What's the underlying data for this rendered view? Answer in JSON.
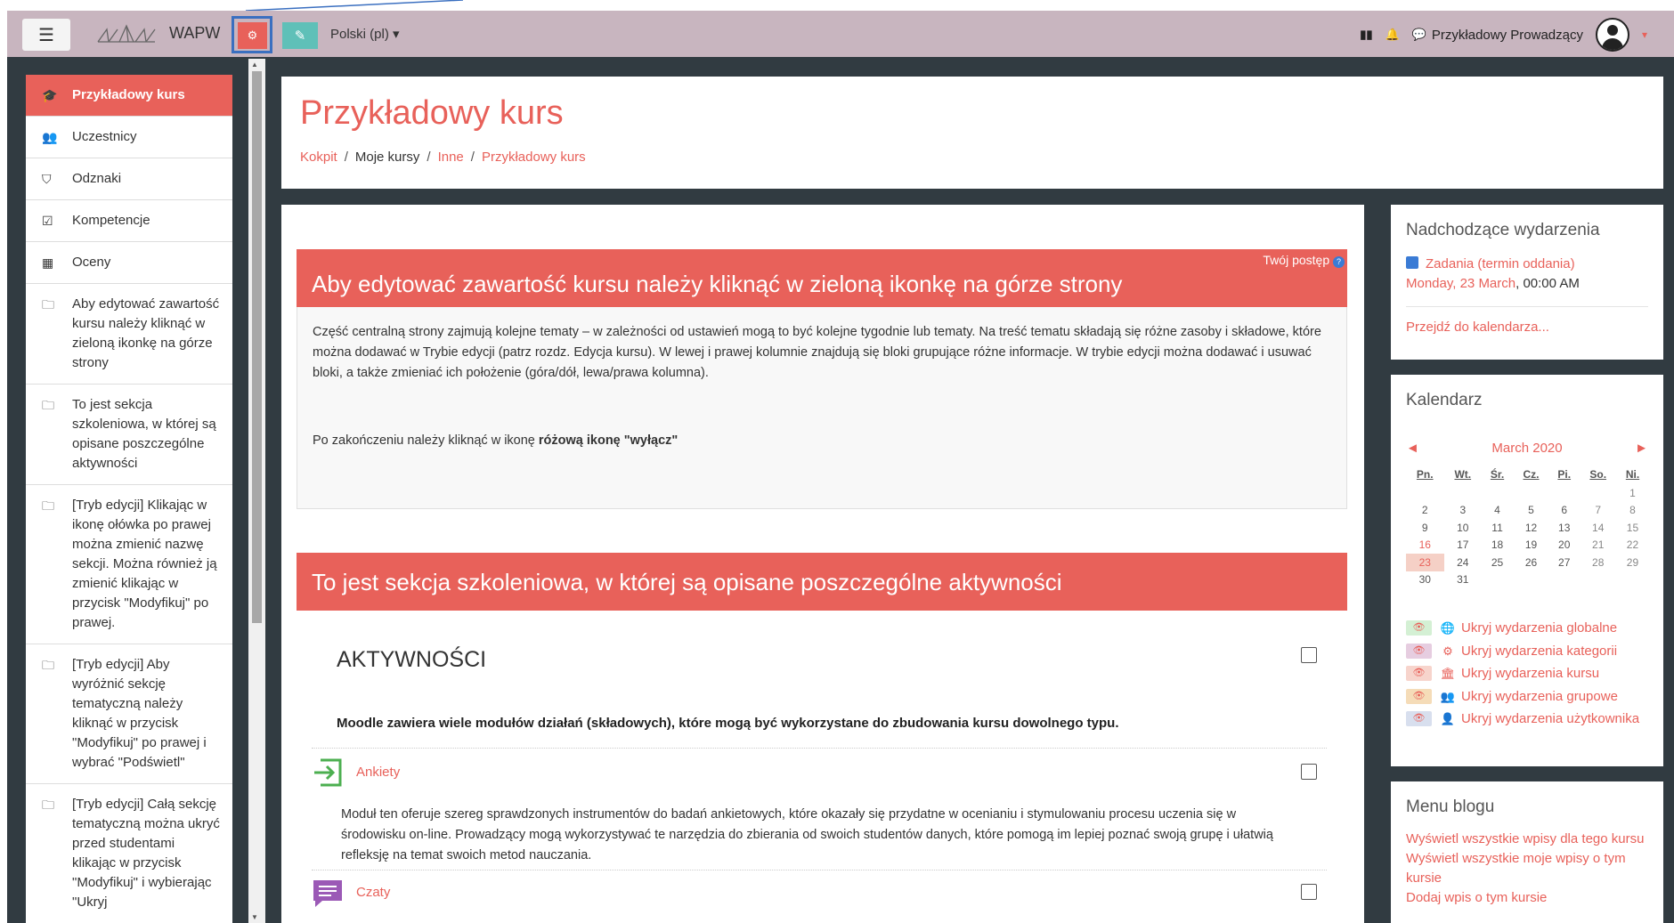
{
  "navbar": {
    "brand": "WAPW",
    "language": "Polski (pl)",
    "language_caret": "▾",
    "user_name": "Przykładowy Prowadzący",
    "user_caret": "▾",
    "icons": {
      "burger": "☰",
      "gear": "⚙",
      "edit": "✎",
      "map": "▮▮",
      "bell": "🔔",
      "chat": "💬"
    }
  },
  "leftnav": {
    "items": [
      {
        "label": "Przykładowy kurs",
        "icon": "🎓"
      },
      {
        "label": "Uczestnicy",
        "icon": "👥"
      },
      {
        "label": "Odznaki",
        "icon": "⛉"
      },
      {
        "label": "Kompetencje",
        "icon": "☑"
      },
      {
        "label": "Oceny",
        "icon": "▦"
      },
      {
        "label": "Aby edytować zawartość kursu należy kliknąć w zieloną ikonkę na górze strony",
        "icon": "🗀"
      },
      {
        "label": "To jest sekcja szkoleniowa, w której są opisane poszczególne aktywności",
        "icon": "🗀"
      },
      {
        "label": "[Tryb edycji] Klikając w ikonę ołówka po prawej można zmienić nazwę sekcji. Można również ją zmienić klikając w przycisk \"Modyfikuj\" po prawej.",
        "icon": "🗀"
      },
      {
        "label": "[Tryb edycji] Aby wyróżnić sekcję tematyczną należy kliknąć w przycisk \"Modyfikuj\" po prawej i wybrać \"Podświetl\"",
        "icon": "🗀"
      },
      {
        "label": "[Tryb edycji] Całą sekcję tematyczną można ukryć przed studentami klikając w przycisk \"Modyfikuj\" i wybierając \"Ukryj",
        "icon": "🗀"
      }
    ]
  },
  "header": {
    "title": "Przykładowy kurs",
    "breadcrumb": [
      "Kokpit",
      "Moje kursy",
      "Inne",
      "Przykładowy kurs"
    ],
    "breadcrumb_sep": "/"
  },
  "main": {
    "progress_label": "Twój postęp",
    "progress_help": "?",
    "section1": {
      "title": "Aby edytować zawartość kursu należy kliknąć w zieloną ikonkę na górze strony",
      "para1": "Część centralną strony zajmują kolejne tematy – w zależności od ustawień  mogą to być kolejne tygodnie lub tematy. Na treść tematu składają się różne zasoby i składowe, które można dodawać w Trybie edycji (patrz rozdz. Edycja kursu). W lewej i prawej kolumnie znajdują się bloki grupujące różne informacje. W trybie edycji można dodawać i usuwać bloki, a także zmieniać ich położenie (góra/dół, lewa/prawa kolumna).",
      "para2_prefix": "Po zakończeniu należy kliknąć w ikonę ",
      "para2_bold": "różową ikonę \"wyłącz\""
    },
    "section2": {
      "title": "To jest sekcja szkoleniowa, w której są opisane poszczególne aktywności",
      "heading": "AKTYWNOŚCI",
      "note": "Moodle zawiera wiele modułów działań (składowych), które mogą być wykorzystane do zbudowania kursu dowolnego typu.",
      "activities": [
        {
          "label": "Ankiety",
          "desc": "Moduł ten oferuje szereg sprawdzonych instrumentów do badań ankietowych, które okazały się przydatne w ocenianiu i stymulowaniu procesu uczenia się w środowisku on-line. Prowadzący mogą wykorzystywać te narzędzia do zbierania od swoich studentów danych, które pomogą im lepiej poznać swoją grupę i ułatwią refleksję na temat swoich metod nauczania."
        },
        {
          "label": "Czaty",
          "desc": ""
        }
      ]
    }
  },
  "right": {
    "upcoming": {
      "title": "Nadchodzące wydarzenia",
      "event_title": "Zadania (termin oddania)",
      "event_date": "Monday, 23 March",
      "event_time": ", 00:00 AM",
      "calendar_link": "Przejdź do kalendarza..."
    },
    "calendar": {
      "title": "Kalendarz",
      "prev": "◄",
      "next": "►",
      "month": "March 2020",
      "weekdays": [
        "Pn.",
        "Wt.",
        "Śr.",
        "Cz.",
        "Pi.",
        "So.",
        "Ni."
      ],
      "weeks": [
        [
          "",
          "",
          "",
          "",
          "",
          "",
          "1"
        ],
        [
          "2",
          "3",
          "4",
          "5",
          "6",
          "7",
          "8"
        ],
        [
          "9",
          "10",
          "11",
          "12",
          "13",
          "14",
          "15"
        ],
        [
          "16",
          "17",
          "18",
          "19",
          "20",
          "21",
          "22"
        ],
        [
          "23",
          "24",
          "25",
          "26",
          "27",
          "28",
          "29"
        ],
        [
          "30",
          "31",
          "",
          "",
          "",
          "",
          ""
        ]
      ],
      "filters": [
        {
          "label": "Ukryj wydarzenia globalne",
          "icon": "🌐",
          "bg": "#d4f0d4"
        },
        {
          "label": "Ukryj wydarzenia kategorii",
          "icon": "⚙",
          "bg": "#e6cde0"
        },
        {
          "label": "Ukryj wydarzenia kursu",
          "icon": "🏛",
          "bg": "#f7d4cc"
        },
        {
          "label": "Ukryj wydarzenia grupowe",
          "icon": "👥",
          "bg": "#f5dcb8"
        },
        {
          "label": "Ukryj wydarzenia użytkownika",
          "icon": "👤",
          "bg": "#d8dfee"
        }
      ],
      "eye": "👁"
    },
    "blog": {
      "title": "Menu blogu",
      "links": [
        "Wyświetl wszystkie wpisy dla tego kursu",
        "Wyświetl wszystkie moje wpisy o tym kursie",
        "Dodaj wpis o tym kursie"
      ]
    }
  },
  "colors": {
    "accent": "#e8615a",
    "navbar": "#c8b5bf",
    "frame": "#313b41",
    "edit_button": "#5fc0b8",
    "highlight": "#3a6fc0"
  }
}
